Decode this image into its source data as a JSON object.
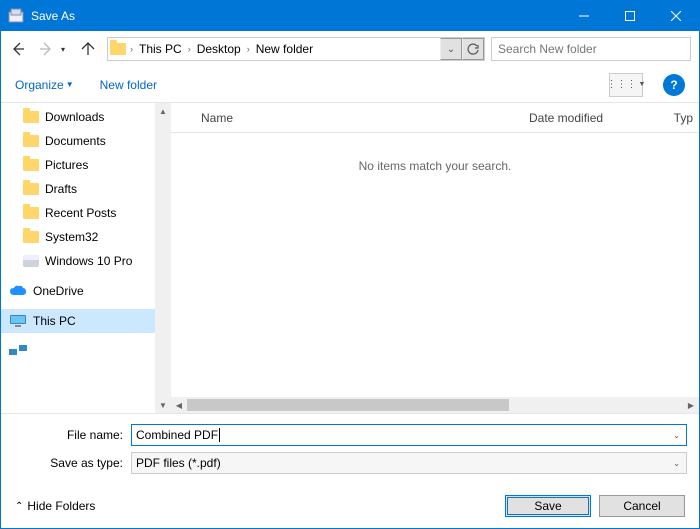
{
  "window": {
    "title": "Save As"
  },
  "breadcrumbs": {
    "b0": "This PC",
    "b1": "Desktop",
    "b2": "New folder"
  },
  "search": {
    "placeholder": "Search New folder"
  },
  "toolbar": {
    "organize": "Organize",
    "new_folder": "New folder"
  },
  "tree": {
    "items": [
      {
        "label": "Downloads",
        "pinned": true
      },
      {
        "label": "Documents",
        "pinned": true
      },
      {
        "label": "Pictures",
        "pinned": true
      },
      {
        "label": "Drafts",
        "pinned": false
      },
      {
        "label": "Recent Posts",
        "pinned": false
      },
      {
        "label": "System32",
        "pinned": false
      },
      {
        "label": "Windows 10 Pro",
        "pinned": false
      }
    ],
    "onedrive": "OneDrive",
    "this_pc": "This PC"
  },
  "columns": {
    "name": "Name",
    "date": "Date modified",
    "type": "Typ"
  },
  "content": {
    "empty_message": "No items match your search."
  },
  "fields": {
    "filename_label": "File name:",
    "filename_value": "Combined PDF",
    "saveastype_label": "Save as type:",
    "saveastype_value": "PDF files (*.pdf)"
  },
  "footer": {
    "hide_folders": "Hide Folders",
    "save": "Save",
    "cancel": "Cancel"
  }
}
